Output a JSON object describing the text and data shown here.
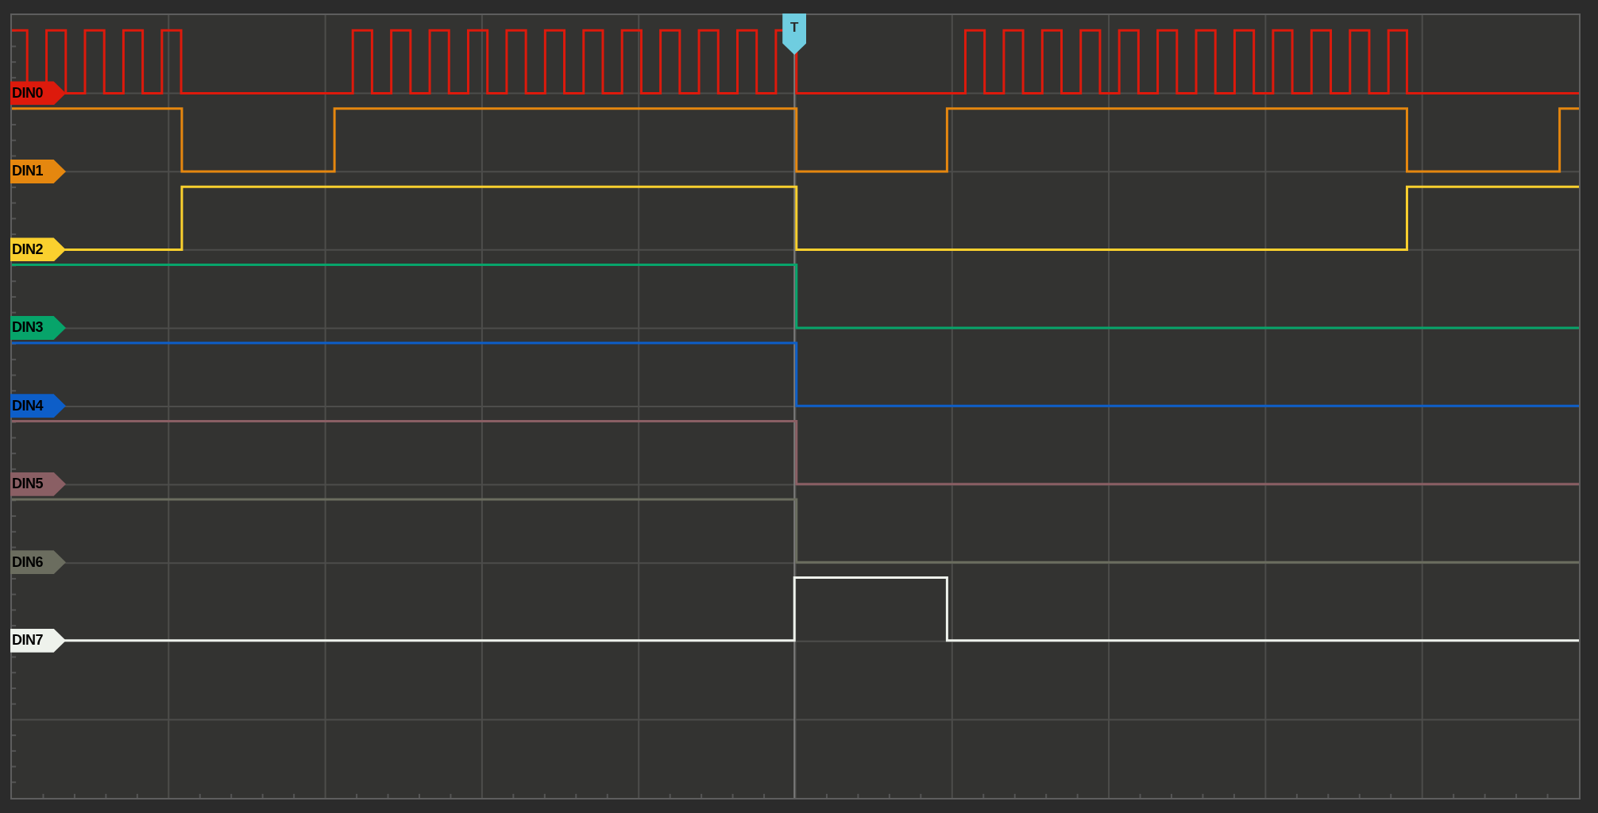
{
  "channels": [
    {
      "label": "DIN0",
      "color": "#dd1a0c"
    },
    {
      "label": "DIN1",
      "color": "#e5870f"
    },
    {
      "label": "DIN2",
      "color": "#fad02e"
    },
    {
      "label": "DIN3",
      "color": "#07a46a"
    },
    {
      "label": "DIN4",
      "color": "#0d5ec8"
    },
    {
      "label": "DIN5",
      "color": "#8a5f64"
    },
    {
      "label": "DIN6",
      "color": "#6b6d5f"
    },
    {
      "label": "DIN7",
      "color": "#eef2ec"
    }
  ],
  "trigger": {
    "label": "T"
  }
}
